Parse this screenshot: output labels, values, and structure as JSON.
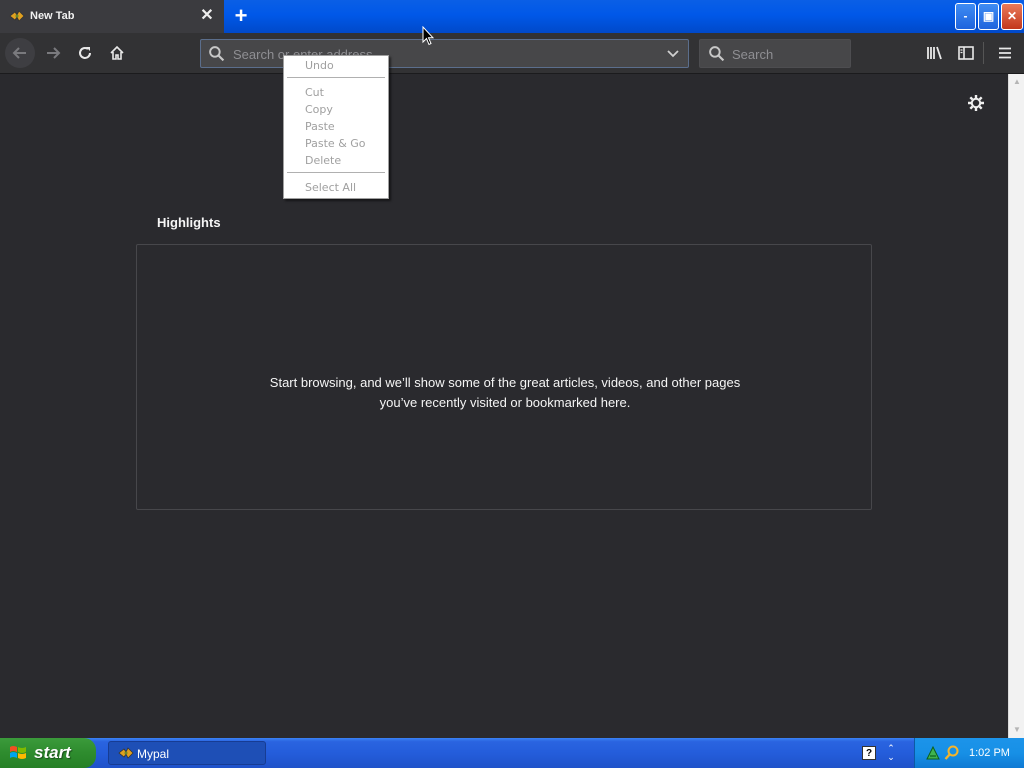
{
  "tab": {
    "title": "New Tab"
  },
  "window_buttons": {
    "minimize": "-",
    "maximize": "▣",
    "close": "✕"
  },
  "toolbar": {
    "url_placeholder": "Search or enter address",
    "search_placeholder": "Search"
  },
  "context_menu": {
    "items": [
      "Undo",
      "Cut",
      "Copy",
      "Paste",
      "Paste & Go",
      "Delete",
      "Select All"
    ],
    "all_disabled": true
  },
  "content": {
    "highlights_title": "Highlights",
    "empty_message": "Start browsing, and we’ll show some of the great articles, videos, and other pages you’ve recently visited or bookmarked here."
  },
  "taskbar": {
    "start_label": "start",
    "tasks": [
      {
        "label": "Mypal"
      }
    ],
    "clock": "1:02 PM",
    "help_glyph": "?"
  },
  "icons": {
    "back": "back-arrow-icon",
    "forward": "forward-arrow-icon",
    "reload": "reload-icon",
    "home": "home-icon",
    "url_search": "search-icon",
    "dropdown": "chevron-down-icon",
    "library": "library-icon",
    "sidebar": "sidebar-icon",
    "menu": "hamburger-menu-icon",
    "settings": "gear-icon"
  },
  "colors": {
    "content_bg": "#2a2a2e",
    "toolbar_bg": "#323234",
    "xp_blue": "#245ddb",
    "start_green": "#2e8c2e"
  }
}
